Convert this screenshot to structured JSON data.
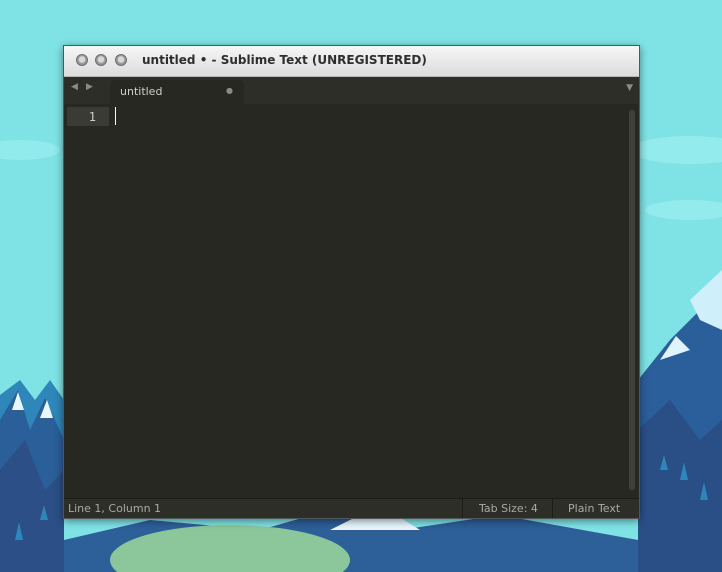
{
  "colors": {
    "sky": "#7fe3e6",
    "editor_bg": "#272822",
    "accent_mountains": "#2e6fa8"
  },
  "window": {
    "title": "untitled • - Sublime Text (UNREGISTERED)",
    "buttons": [
      "close-icon",
      "minimize-icon",
      "maximize-icon"
    ]
  },
  "tabbar": {
    "nav_back": "◀",
    "nav_forward": "▶",
    "tab_label": "untitled",
    "tab_close": "●",
    "menu": "▼"
  },
  "editor": {
    "line_numbers": [
      "1"
    ]
  },
  "status": {
    "position": "Line 1, Column 1",
    "tab_size": "Tab Size: 4",
    "syntax": "Plain Text"
  }
}
